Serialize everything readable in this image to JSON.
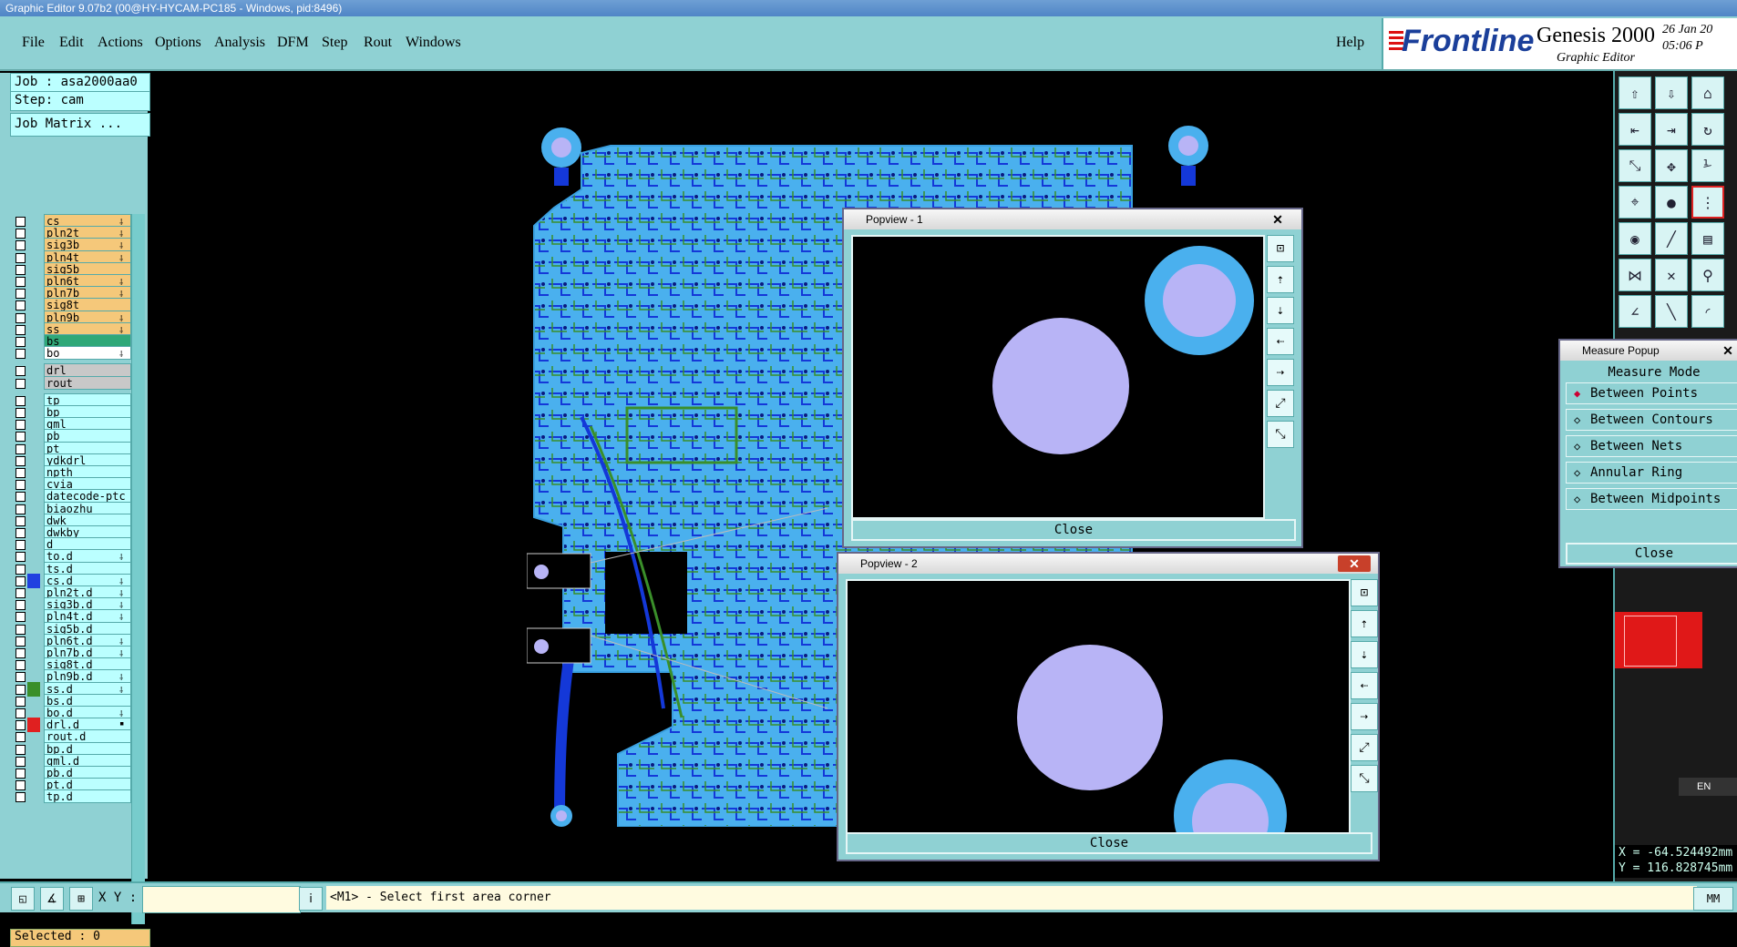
{
  "window": {
    "title": "Graphic Editor 9.07b2 (00@HY-HYCAM-PC185 - Windows, pid:8496)"
  },
  "menu": {
    "items": [
      "File",
      "Edit",
      "Actions",
      "Options",
      "Analysis",
      "DFM",
      "Step",
      "Rout",
      "Windows"
    ],
    "help": "Help"
  },
  "brand": {
    "logo": "Frontline",
    "product": "Genesis 2000",
    "subtitle": "Graphic Editor",
    "date": "26 Jan 20",
    "time": "05:06 P"
  },
  "job": {
    "job_label": "Job : asa2000aa0",
    "step_label": "Step: cam",
    "matrix_button": "Job Matrix ..."
  },
  "layers": [
    {
      "name": "cs",
      "color": "#f5c87a",
      "mark": "⸸"
    },
    {
      "name": "pln2t",
      "color": "#f5c87a",
      "mark": "⸸"
    },
    {
      "name": "sig3b",
      "color": "#f5c87a",
      "mark": "⸸"
    },
    {
      "name": "pln4t",
      "color": "#f5c87a",
      "mark": "⸸"
    },
    {
      "name": "sig5b",
      "color": "#f5c87a",
      "mark": ""
    },
    {
      "name": "pln6t",
      "color": "#f5c87a",
      "mark": "⸸"
    },
    {
      "name": "pln7b",
      "color": "#f5c87a",
      "mark": "⸸"
    },
    {
      "name": "sig8t",
      "color": "#f5c87a",
      "mark": ""
    },
    {
      "name": "pln9b",
      "color": "#f5c87a",
      "mark": "⸸"
    },
    {
      "name": "ss",
      "color": "#f5c87a",
      "mark": "⸸"
    },
    {
      "name": "bs",
      "color": "#2fa878",
      "mark": ""
    },
    {
      "name": "bo",
      "color": "#ffffff",
      "mark": "⸸"
    },
    {
      "name": "drl",
      "color": "#c8c8c8",
      "mark": ""
    },
    {
      "name": "rout",
      "color": "#c8c8c8",
      "mark": ""
    },
    {
      "name": "tp",
      "color": "#bff",
      "mark": ""
    },
    {
      "name": "bp",
      "color": "#bff",
      "mark": ""
    },
    {
      "name": "gml",
      "color": "#bff",
      "mark": ""
    },
    {
      "name": "pb",
      "color": "#bff",
      "mark": ""
    },
    {
      "name": "pt",
      "color": "#bff",
      "mark": ""
    },
    {
      "name": "ydkdrl",
      "color": "#bff",
      "mark": ""
    },
    {
      "name": "npth",
      "color": "#bff",
      "mark": ""
    },
    {
      "name": "cvia",
      "color": "#bff",
      "mark": ""
    },
    {
      "name": "datecode-ptc",
      "color": "#bff",
      "mark": ""
    },
    {
      "name": "biaozhu",
      "color": "#bff",
      "mark": ""
    },
    {
      "name": "dwk",
      "color": "#bff",
      "mark": ""
    },
    {
      "name": "dwkby",
      "color": "#bff",
      "mark": ""
    },
    {
      "name": "d",
      "color": "#bff",
      "mark": ""
    },
    {
      "name": "to.d",
      "color": "#bff",
      "mark": "⸸"
    },
    {
      "name": "ts.d",
      "color": "#bff",
      "mark": ""
    },
    {
      "name": "cs.d",
      "color": "#bff",
      "mark": "⸸",
      "swatch": "#2040e0"
    },
    {
      "name": "pln2t.d",
      "color": "#bff",
      "mark": "⸸"
    },
    {
      "name": "sig3b.d",
      "color": "#bff",
      "mark": "⸸"
    },
    {
      "name": "pln4t.d",
      "color": "#bff",
      "mark": "⸸"
    },
    {
      "name": "sig5b.d",
      "color": "#bff",
      "mark": ""
    },
    {
      "name": "pln6t.d",
      "color": "#bff",
      "mark": "⸸"
    },
    {
      "name": "pln7b.d",
      "color": "#bff",
      "mark": "⸸"
    },
    {
      "name": "sig8t.d",
      "color": "#bff",
      "mark": ""
    },
    {
      "name": "pln9b.d",
      "color": "#bff",
      "mark": "⸸"
    },
    {
      "name": "ss.d",
      "color": "#bff",
      "mark": "⸸",
      "swatch": "#3a8f2a"
    },
    {
      "name": "bs.d",
      "color": "#bff",
      "mark": ""
    },
    {
      "name": "bo.d",
      "color": "#bff",
      "mark": "⸸"
    },
    {
      "name": "drl.d",
      "color": "#bff",
      "mark": "▪",
      "swatch": "#e02020"
    },
    {
      "name": "rout.d",
      "color": "#bff",
      "mark": ""
    },
    {
      "name": "bp.d",
      "color": "#bff",
      "mark": ""
    },
    {
      "name": "gml.d",
      "color": "#bff",
      "mark": ""
    },
    {
      "name": "pb.d",
      "color": "#bff",
      "mark": ""
    },
    {
      "name": "pt.d",
      "color": "#bff",
      "mark": ""
    },
    {
      "name": "tp.d",
      "color": "#bff",
      "mark": ""
    }
  ],
  "selected": "Selected : 0",
  "popview1": {
    "title": "Popview - 1",
    "close": "Close",
    "close_x": "✕"
  },
  "popview2": {
    "title": "Popview - 2",
    "close": "Close",
    "close_x": "✕"
  },
  "measure": {
    "title": "Measure Popup",
    "mode_label": "Measure Mode",
    "options": [
      "Between Points",
      "Between Contours",
      "Between Nets",
      "Annular Ring",
      "Between Midpoints"
    ],
    "selected_option": "Between Points",
    "close": "Close",
    "close_x": "✕"
  },
  "bottom": {
    "xy_label": "X Y :",
    "xy_value": "",
    "prompt": "<M1> - Select first area corner",
    "units": "MM"
  },
  "coords": {
    "x": "X = -64.524492mm",
    "y": "Y = 116.828745mm"
  },
  "lang": "EN",
  "colors": {
    "panel": "#8fd1d3",
    "board_fill": "#4ab0ee",
    "pad": "#b8b4f6",
    "pad_ring": "#4ab0ee",
    "trace_blue": "#1438d8",
    "trace_green": "#3a8f2a"
  }
}
